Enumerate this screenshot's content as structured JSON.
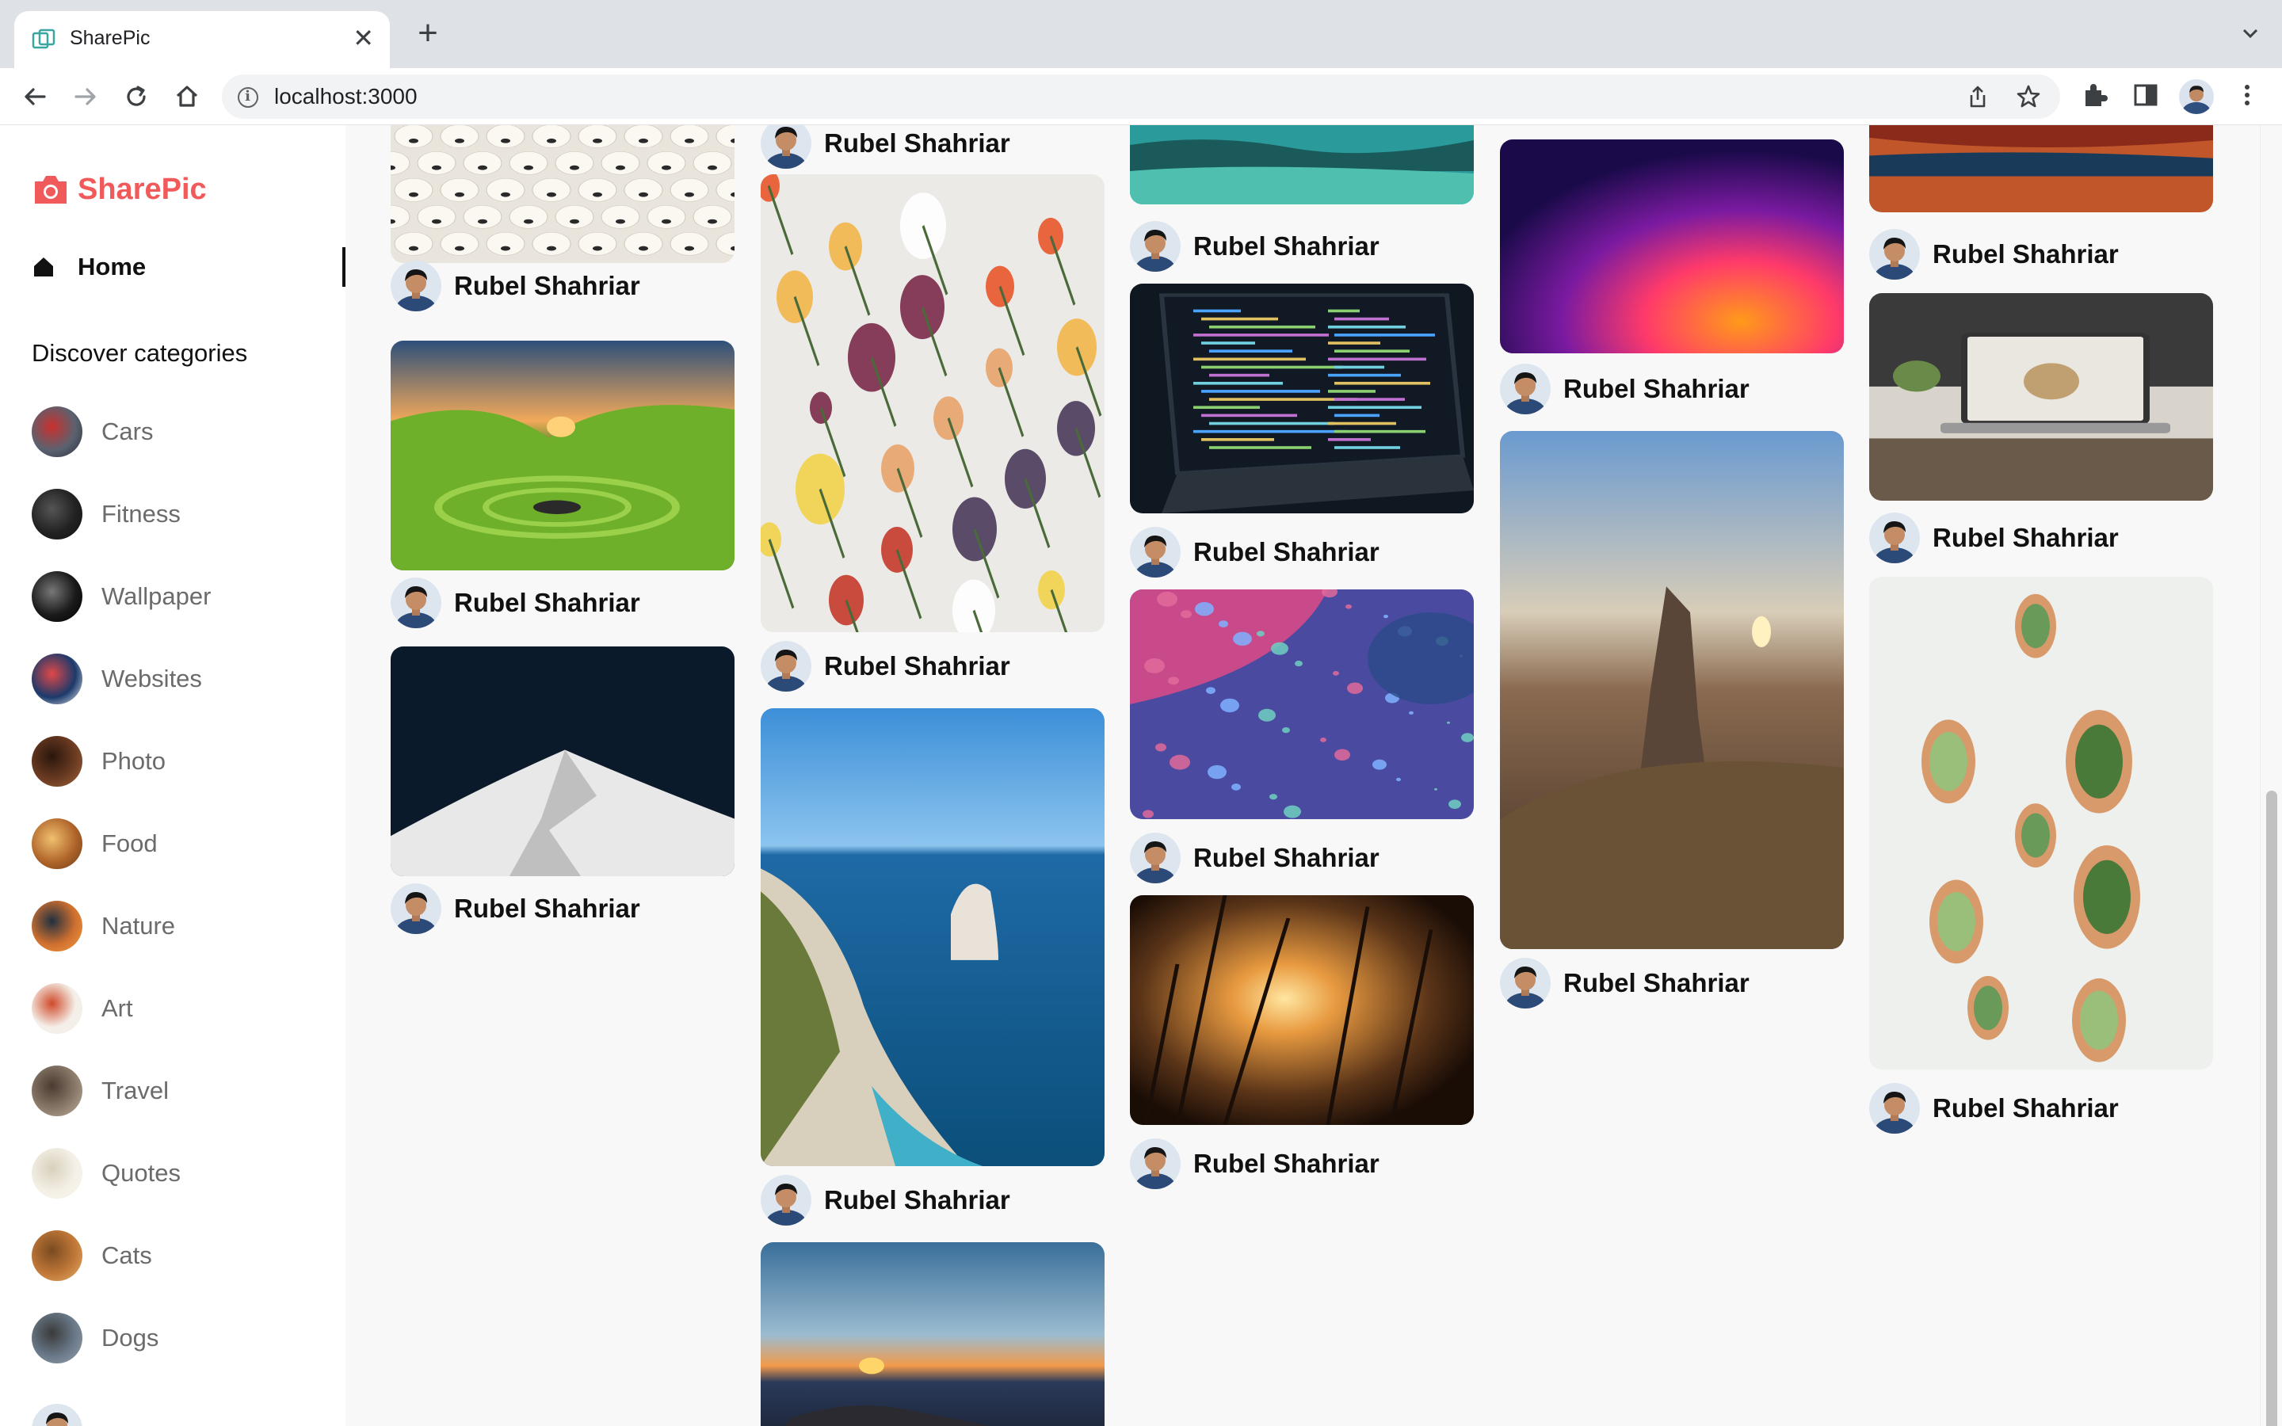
{
  "browser": {
    "tab_title": "SharePic",
    "new_tab_symbol": "+",
    "close_symbol": "✕",
    "url": "localhost:3000",
    "icons": [
      "back-icon",
      "forward-icon",
      "reload-icon",
      "home-icon",
      "info-icon",
      "share-icon",
      "star-icon",
      "extensions-icon",
      "side-panel-icon",
      "profile-avatar",
      "menu-icon"
    ]
  },
  "app": {
    "brand": "SharePic",
    "brand_color": "#f05a5a",
    "nav_home": "Home",
    "discover_title": "Discover categories",
    "categories": [
      "Cars",
      "Fitness",
      "Wallpaper",
      "Websites",
      "Photo",
      "Food",
      "Nature",
      "Art",
      "Travel",
      "Quotes",
      "Cats",
      "Dogs"
    ]
  },
  "feed": {
    "author_name": "Rubel Shahriar",
    "pins": [
      {
        "author": "Rubel Shahriar",
        "image": "paper lanterns"
      },
      {
        "author": "Rubel Shahriar",
        "image": "green valley"
      },
      {
        "author": "Rubel Shahriar",
        "image": "snowy peak"
      },
      {
        "author": "Rubel Shahriar",
        "image": "pressed flowers"
      },
      {
        "author": "Rubel Shahriar",
        "image": "coastal cliffs"
      },
      {
        "author": "Rubel Shahriar",
        "image": "sunset horizon"
      },
      {
        "author": "Rubel Shahriar",
        "image": "aqua reef"
      },
      {
        "author": "Rubel Shahriar",
        "image": "laptop code"
      },
      {
        "author": "Rubel Shahriar",
        "image": "paint bubbles"
      },
      {
        "author": "Rubel Shahriar",
        "image": "grass sunset"
      },
      {
        "author": "Rubel Shahriar",
        "image": "gradient wallpaper"
      },
      {
        "author": "Rubel Shahriar",
        "image": "mountain sunrise"
      },
      {
        "author": "Rubel Shahriar",
        "image": "autumn lake"
      },
      {
        "author": "Rubel Shahriar",
        "image": "laptop desk"
      },
      {
        "author": "Rubel Shahriar",
        "image": "succulents"
      }
    ]
  }
}
